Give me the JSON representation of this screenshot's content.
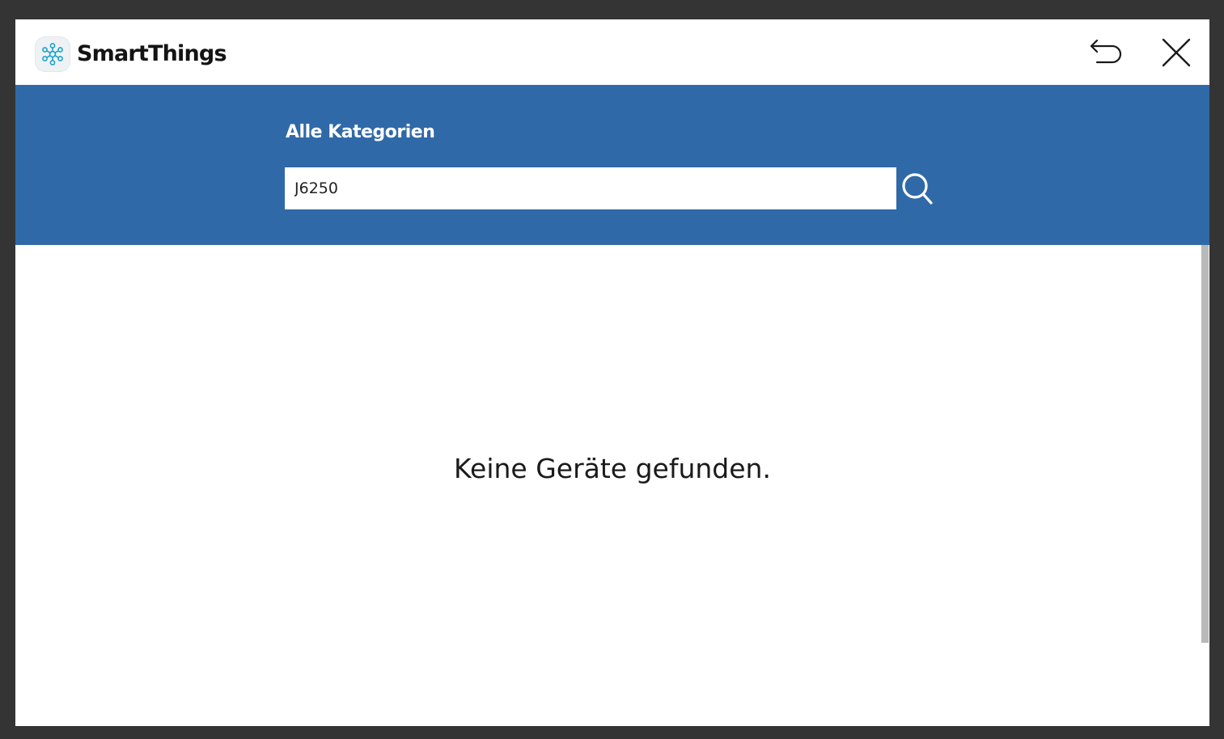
{
  "app": {
    "title": "SmartThings",
    "logo_icon": "smartthings-logo-icon"
  },
  "header": {
    "back_icon": "back-arrow-icon",
    "close_icon": "close-icon"
  },
  "search": {
    "category_title": "Alle Kategorien",
    "query": "J6250",
    "search_icon": "search-icon"
  },
  "results": {
    "empty_message": "Keine Geräte gefunden."
  },
  "colors": {
    "accent_band": "#2f69a8",
    "backdrop": "#343434",
    "logo_teal": "#1aa3c8"
  }
}
